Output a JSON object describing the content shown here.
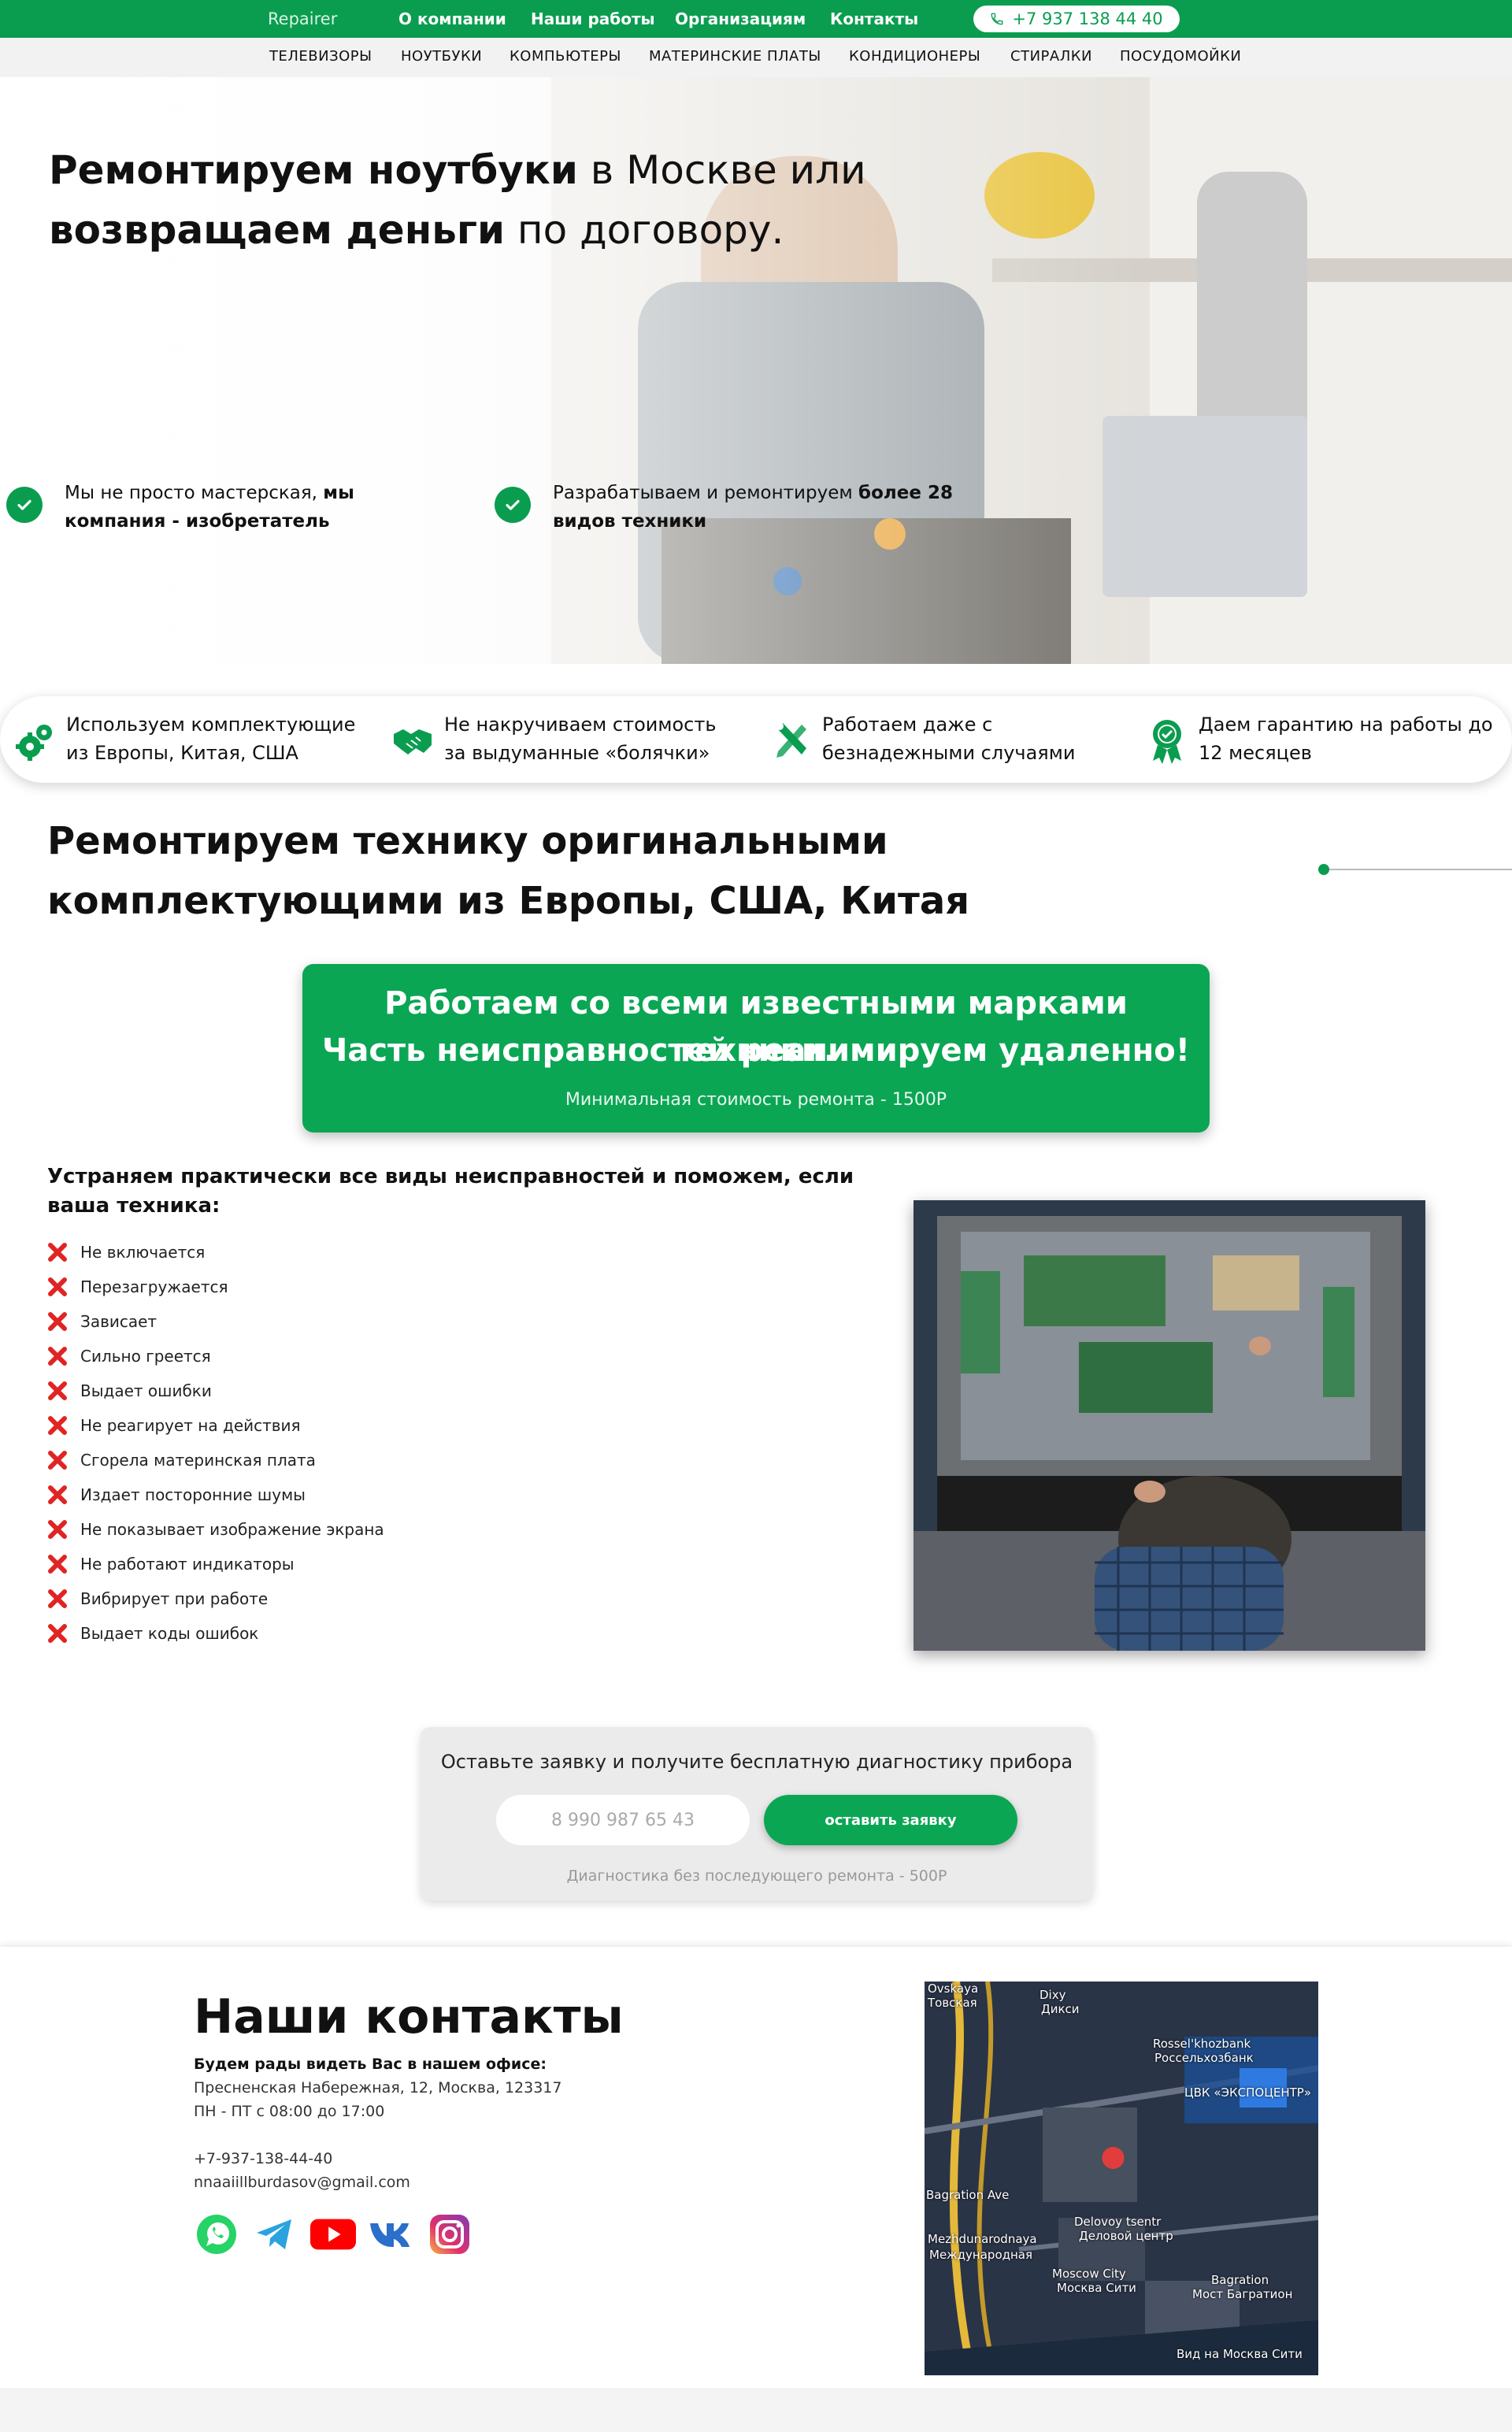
{
  "topbar": {
    "brand": "Repairer",
    "nav": [
      "О компании",
      "Наши работы",
      "Организациям",
      "Контакты"
    ],
    "phone": "+7 937 138 44 40",
    "bg_color": "#0a9d50"
  },
  "categories": [
    "ТЕЛЕВИЗОРЫ",
    "НОУТБУКИ",
    "КОМПЬЮТЕРЫ",
    "МАТЕРИНСКИЕ ПЛАТЫ",
    "КОНДИЦИОНЕРЫ",
    "СТИРАЛКИ",
    "ПОСУДОМОЙКИ"
  ],
  "hero": {
    "title_b1": "Ремонтируем ноутбуки",
    "title_n1": " в Москве или",
    "title_b2": "возвращаем деньги",
    "title_n2": " по договору.",
    "feature1_normal": "Мы не просто мастерская, ",
    "feature1_bold": "мы компания - изобретатель",
    "feature2_normal": "Разрабатываем и ремонтируем ",
    "feature2_bold": "более 28 видов техники"
  },
  "benefits": [
    {
      "icon": "gears-icon",
      "text": "Используем комплектующие из Европы, Китая, США"
    },
    {
      "icon": "handshake-icon",
      "text": "Не накручиваем стоимость за выдуманные «болячки»"
    },
    {
      "icon": "tools-icon",
      "text": "Работаем даже с безнадежными случаями"
    },
    {
      "icon": "award-icon",
      "text": "Даем гарантию на работы до 12 месяцев"
    }
  ],
  "section2": {
    "title": "Ремонтируем технику оригинальными комплектующими из Европы, США, Китая",
    "card_line1": "Работаем со всеми известными марками техники.",
    "card_line2": "Часть неисправностей реанимируем удаленно!",
    "card_line3": "Минимальная стоимость ремонта - 1500Р",
    "problems_head": "Устраняем практически все виды неисправностей и поможем, если ваша техника:",
    "problems": [
      "Не включается",
      "Перезагружается",
      "Зависает",
      "Сильно греется",
      "Выдает ошибки",
      "Не реагирует на действия",
      "Сгорела материнская плата",
      "Издает посторонние шумы",
      "Не показывает изображение экрана",
      "Не работают индикаторы",
      "Вибрирует при работе",
      "Выдает коды ошибок"
    ]
  },
  "request": {
    "title": "Оставьте заявку и получите бесплатную диагностику прибора",
    "placeholder": "8 990 987 65 43",
    "button": "оставить заявку",
    "note": "Диагностика без последующего ремонта - 500Р"
  },
  "contacts": {
    "title": "Наши контакты",
    "lead": "Будем рады видеть Вас в нашем офисе:",
    "address": "Пресненская Набережная, 12, Москва, 123317",
    "hours": "ПН - ПТ с 08:00 до 17:00",
    "phone": "+7-937-138-44-40",
    "email": "nnaaiillburdasov@gmail.com",
    "social": [
      "whatsapp-icon",
      "telegram-icon",
      "youtube-icon",
      "vk-icon",
      "instagram-icon"
    ],
    "map_labels": [
      "Dixy",
      "Дикси",
      "Rossel'khozbank",
      "Россельхозбанк",
      "ЦВК «ЭКСПОЦЕНТР»",
      "Delovoy tsentr",
      "Деловой центр",
      "Mezhdunarodnaya",
      "Международная",
      "Moscow City",
      "Москва Сити",
      "Bagration",
      "Мост Багратион",
      "Вид на Москва Сити",
      "Ovskaya",
      "Товская",
      "Bagration Ave"
    ]
  }
}
